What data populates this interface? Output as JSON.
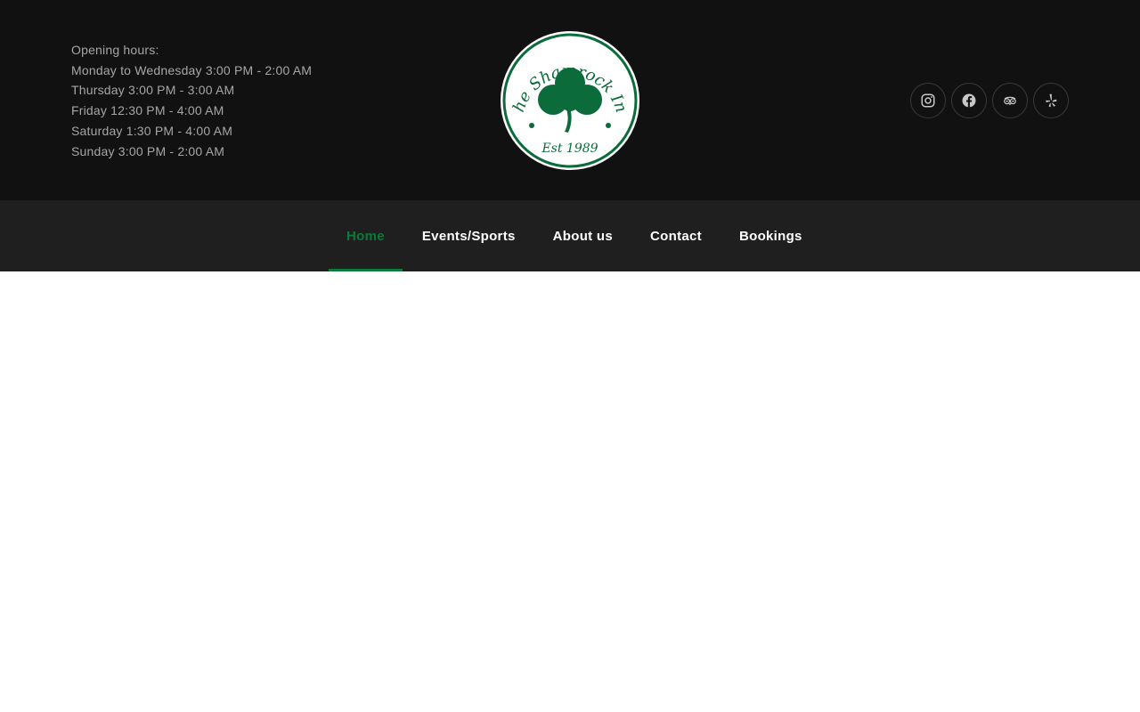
{
  "header": {
    "hours_title": "Opening hours:",
    "hours": [
      "Monday to Wednesday 3:00 PM - 2:00 AM",
      "Thursday 3:00 PM - 3:00 AM",
      "Friday 12:30 PM - 4:00 AM",
      "Saturday 1:30 PM - 4:00 AM",
      "Sunday 3:00 PM - 2:00 AM"
    ],
    "logo": {
      "name": "The Shamrock Inn",
      "top_text": "The Shamrock Inn",
      "bottom_text": "Est 1989",
      "color": "#0b6b3a"
    },
    "social": [
      {
        "icon": "instagram-icon"
      },
      {
        "icon": "facebook-icon"
      },
      {
        "icon": "tripadvisor-icon"
      },
      {
        "icon": "yelp-icon"
      }
    ]
  },
  "nav": {
    "items": [
      {
        "label": "Home",
        "active": true
      },
      {
        "label": "Events/Sports",
        "active": false
      },
      {
        "label": "About us",
        "active": false
      },
      {
        "label": "Contact",
        "active": false
      },
      {
        "label": "Bookings",
        "active": false
      }
    ],
    "active_color": "#0b7a3b"
  },
  "colors": {
    "topbar_bg": "#111111",
    "navbar_bg": "#1f1f1f",
    "hours_text": "#a6a6a6",
    "icon": "#c8c8c8"
  }
}
